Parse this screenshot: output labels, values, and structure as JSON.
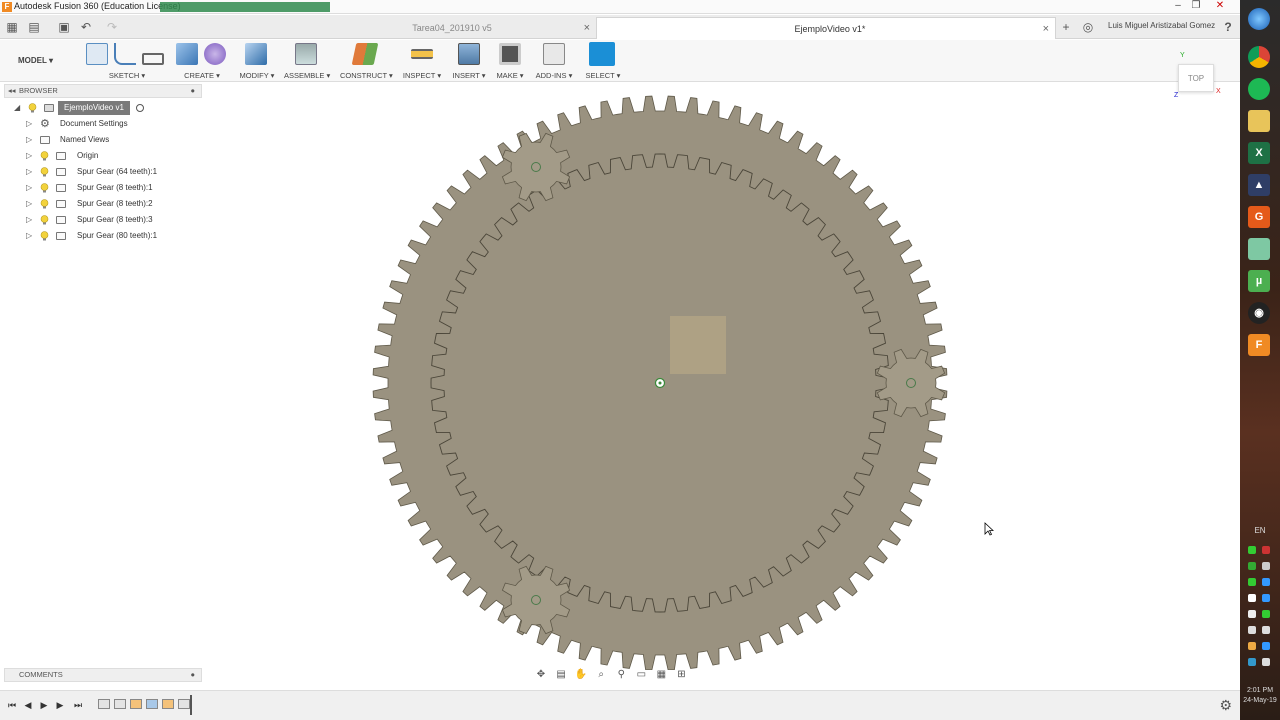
{
  "window": {
    "app_title": "Autodesk Fusion 360 (Education License)",
    "minimize": "–",
    "maximize": "❐",
    "close": "✕"
  },
  "tabs": [
    {
      "label": "Tarea04_201910 v5",
      "active": false
    },
    {
      "label": "EjemploVideo v1*",
      "active": true
    }
  ],
  "tab_close": "×",
  "tab_add": "+",
  "user": {
    "name": "Luis Miguel Aristizabal Gomez",
    "help": "?"
  },
  "toolbar": {
    "workspace": "MODEL",
    "groups": [
      {
        "label": "SKETCH",
        "icons": [
          "sketch-icon",
          "arc-icon",
          "rectangle-icon"
        ]
      },
      {
        "label": "CREATE",
        "icons": [
          "extrude-icon",
          "form-icon"
        ]
      },
      {
        "label": "MODIFY",
        "icons": [
          "press-pull-icon"
        ]
      },
      {
        "label": "ASSEMBLE",
        "icons": [
          "joint-icon"
        ]
      },
      {
        "label": "CONSTRUCT",
        "icons": [
          "plane-icon"
        ]
      },
      {
        "label": "INSPECT",
        "icons": [
          "measure-icon"
        ]
      },
      {
        "label": "INSERT",
        "icons": [
          "image-icon"
        ]
      },
      {
        "label": "MAKE",
        "icons": [
          "print-icon"
        ]
      },
      {
        "label": "ADD-INS",
        "icons": [
          "scripts-icon"
        ]
      },
      {
        "label": "SELECT",
        "icons": [
          "select-icon"
        ]
      }
    ]
  },
  "browser": {
    "header": "BROWSER",
    "root": "EjemploVideo v1",
    "items": [
      {
        "label": "Document Settings"
      },
      {
        "label": "Named Views"
      },
      {
        "label": "Origin"
      },
      {
        "label": "Spur Gear (64 teeth):1"
      },
      {
        "label": "Spur Gear (8 teeth):1"
      },
      {
        "label": "Spur Gear (8 teeth):2"
      },
      {
        "label": "Spur Gear (8 teeth):3"
      },
      {
        "label": "Spur Gear (80 teeth):1"
      }
    ]
  },
  "comments": {
    "header": "COMMENTS"
  },
  "viewcube": {
    "face": "TOP",
    "x": "X",
    "y": "Y",
    "z": "Z"
  },
  "colors": {
    "gear_fill": "#9a9280",
    "gear_stroke": "#5e5848",
    "select_blue": "#1b8fd6",
    "accent_orange": "#f08a24"
  },
  "tray": {
    "lang": "EN",
    "time": "2:01 PM",
    "date": "24-May-19"
  }
}
